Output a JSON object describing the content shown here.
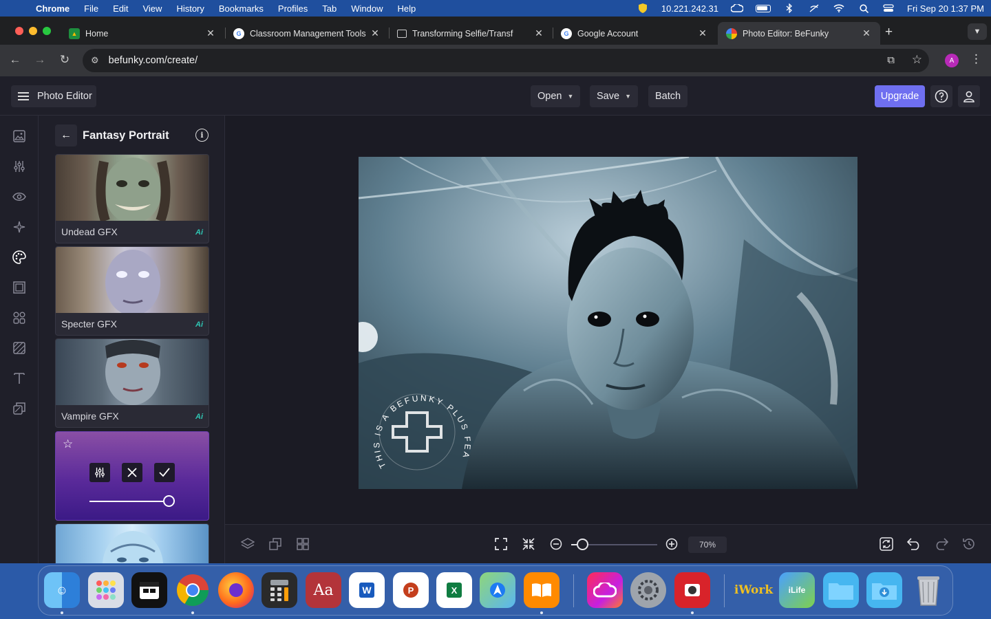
{
  "menubar": {
    "app_name": "Chrome",
    "items": [
      "File",
      "Edit",
      "View",
      "History",
      "Bookmarks",
      "Profiles",
      "Tab",
      "Window",
      "Help"
    ],
    "ip": "10.221.242.31",
    "datetime": "Fri Sep 20  1:37 PM"
  },
  "tabs": [
    {
      "title": "Home",
      "favicon": "classroom-icon"
    },
    {
      "title": "Classroom Management Tools",
      "favicon": "google-icon"
    },
    {
      "title": "Transforming Selfie/Transf",
      "favicon": "image-icon"
    },
    {
      "title": "Google Account",
      "favicon": "google-icon"
    },
    {
      "title": "Photo Editor: BeFunky",
      "favicon": "befunky-icon",
      "active": true
    }
  ],
  "toolbar": {
    "url": "befunky.com/create/",
    "profile_initial": "A"
  },
  "app": {
    "menu_label": "Photo Editor",
    "open_label": "Open",
    "save_label": "Save",
    "batch_label": "Batch",
    "upgrade_label": "Upgrade",
    "accent_color": "#6f6ff0"
  },
  "panel": {
    "title": "Fantasy Portrait",
    "effects": [
      {
        "label": "Undead GFX",
        "badge": "Ai"
      },
      {
        "label": "Specter GFX",
        "badge": "Ai"
      },
      {
        "label": "Vampire GFX",
        "badge": "Ai"
      }
    ],
    "active_effect": {
      "intensity": 1.0
    }
  },
  "canvas": {
    "watermark": "THIS IS A BEFUNKY PLUS FEATURE"
  },
  "zoom": {
    "level_label": "70%",
    "level": 70
  },
  "dock": {
    "apps": [
      "Finder",
      "Launchpad",
      "Notion Calendar",
      "Chrome",
      "Firefox",
      "Calculator",
      "Dictionary",
      "Word",
      "PowerPoint",
      "Excel",
      "Maps",
      "Books",
      "Creative Cloud",
      "System Settings",
      "Photo Booth",
      "iWork",
      "iLife",
      "Folder",
      "Downloads",
      "Trash"
    ]
  }
}
